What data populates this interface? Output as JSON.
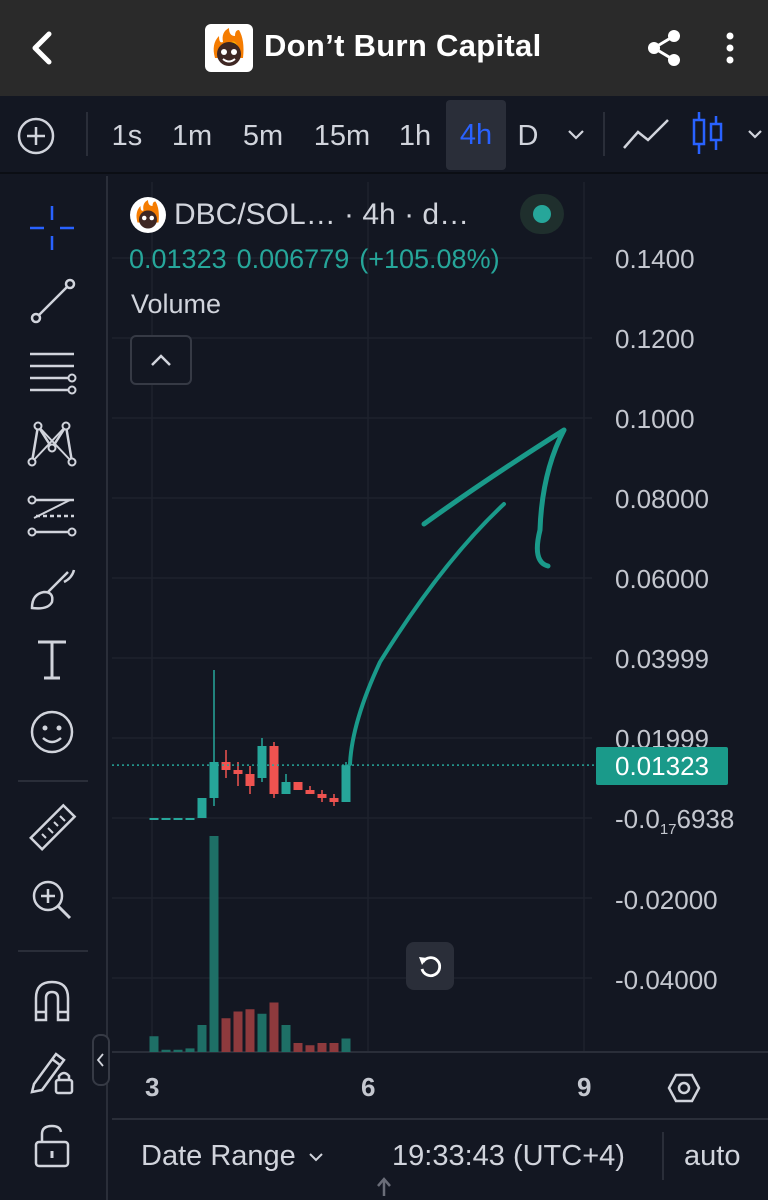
{
  "app": {
    "title": "Don’t Burn Capital",
    "logo_icon": "flaming-skull-logo"
  },
  "toolbar": {
    "intervals": [
      "1s",
      "1m",
      "5m",
      "15m",
      "1h",
      "4h",
      "D"
    ],
    "active_interval": "4h",
    "accent": "#2962ff"
  },
  "legend": {
    "symbol": "DBC/SOL… · 4h · d…",
    "last": "0.01323",
    "change": "0.006779",
    "change_pct": "(+105.08%)",
    "volume_label": "Volume",
    "up_color": "#26a69a",
    "down_color": "#ef5350"
  },
  "price_axis": {
    "labels": [
      "0.1400",
      "0.1200",
      "0.1000",
      "0.08000",
      "0.06000",
      "0.03999",
      "0.01999",
      "-0.02000",
      "-0.04000"
    ],
    "special_label_prefix": "-0.0",
    "special_label_sub": "17",
    "special_label_suffix": "6938",
    "current_price": "0.01323"
  },
  "time_axis": {
    "labels": [
      "3",
      "6",
      "9"
    ]
  },
  "bottom": {
    "date_range": "Date Range",
    "clock": "19:33:43 (UTC+4)",
    "scale_mode": "auto"
  },
  "chart_data": {
    "type": "candlestick",
    "xlabel": "",
    "ylabel": "",
    "ylim": [
      -0.06,
      0.15
    ],
    "current_price": 0.01323,
    "candles": [
      {
        "o": 0.0,
        "h": 0.0,
        "l": 0.0,
        "c": 0.0
      },
      {
        "o": 0.0,
        "h": 0.0,
        "l": 0.0,
        "c": 0.0
      },
      {
        "o": 0.0,
        "h": 0.0,
        "l": 0.0,
        "c": 0.0
      },
      {
        "o": 0.0,
        "h": 0.0,
        "l": 0.0,
        "c": 0.0
      },
      {
        "o": 0.0,
        "h": 0.005,
        "l": 0.0,
        "c": 0.005
      },
      {
        "o": 0.005,
        "h": 0.037,
        "l": 0.003,
        "c": 0.014
      },
      {
        "o": 0.014,
        "h": 0.017,
        "l": 0.01,
        "c": 0.012
      },
      {
        "o": 0.012,
        "h": 0.014,
        "l": 0.008,
        "c": 0.011
      },
      {
        "o": 0.011,
        "h": 0.013,
        "l": 0.006,
        "c": 0.008
      },
      {
        "o": 0.01,
        "h": 0.02,
        "l": 0.009,
        "c": 0.018
      },
      {
        "o": 0.018,
        "h": 0.019,
        "l": 0.005,
        "c": 0.006
      },
      {
        "o": 0.006,
        "h": 0.011,
        "l": 0.006,
        "c": 0.009
      },
      {
        "o": 0.009,
        "h": 0.009,
        "l": 0.007,
        "c": 0.007
      },
      {
        "o": 0.007,
        "h": 0.008,
        "l": 0.006,
        "c": 0.006
      },
      {
        "o": 0.006,
        "h": 0.007,
        "l": 0.004,
        "c": 0.005
      },
      {
        "o": 0.005,
        "h": 0.006,
        "l": 0.003,
        "c": 0.004
      },
      {
        "o": 0.004,
        "h": 0.014,
        "l": 0.004,
        "c": 0.0132
      }
    ],
    "volumes": [
      0.35,
      0.05,
      0.05,
      0.08,
      0.6,
      4.8,
      0.75,
      0.9,
      0.95,
      0.85,
      1.1,
      0.6,
      0.2,
      0.15,
      0.2,
      0.2,
      0.3
    ],
    "time_ticks": [
      "3",
      "6",
      "9"
    ]
  }
}
